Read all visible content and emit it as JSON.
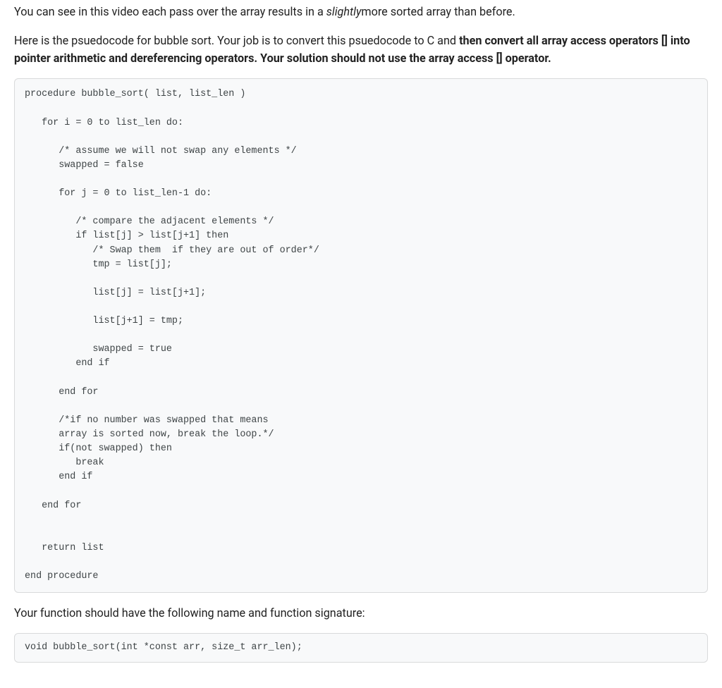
{
  "paragraphs": {
    "intro": {
      "prefix": "You can see in this video each pass over the array results in a ",
      "em": "slightly",
      "suffix": "more sorted array than before."
    },
    "task": {
      "p1": "Here is the psuedocode for bubble sort. Your job is to convert this psuedocode to C and ",
      "s1": "then convert all array access operators [] into pointer arithmetic and dereferencing operators. Your solution should not use the array access [] operator."
    },
    "sigLead": "Your function should have the following name and function signature:"
  },
  "pseudocode": "procedure bubble_sort( list, list_len )\n\n   for i = 0 to list_len do:\n\n      /* assume we will not swap any elements */\n      swapped = false\n\n      for j = 0 to list_len-1 do:\n\n         /* compare the adjacent elements */\n         if list[j] > list[j+1] then\n            /* Swap them  if they are out of order*/\n            tmp = list[j];\n\n            list[j] = list[j+1];\n\n            list[j+1] = tmp;\n\n            swapped = true\n         end if\n\n      end for\n\n      /*if no number was swapped that means\n      array is sorted now, break the loop.*/\n      if(not swapped) then\n         break\n      end if\n\n   end for\n\n\n   return list\n\nend procedure",
  "signature": "void bubble_sort(int *const arr, size_t arr_len);"
}
